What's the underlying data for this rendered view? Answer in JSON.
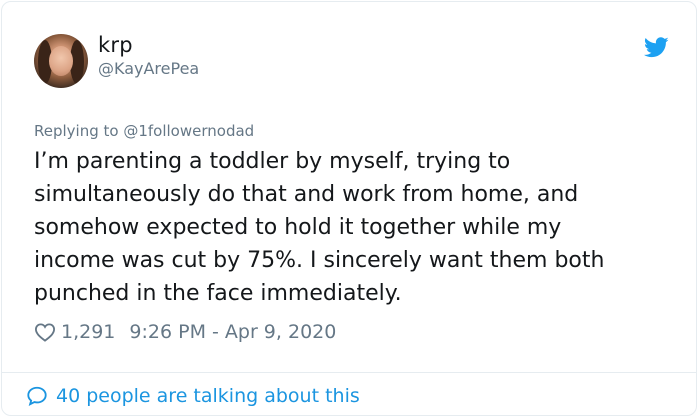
{
  "author": {
    "display_name": "krp",
    "handle": "@KayArePea"
  },
  "reply": {
    "prefix": "Replying to ",
    "mention": "@1followernodad"
  },
  "tweet": {
    "text": "I’m parenting a toddler by myself, trying to\nsimultaneously do that and work from home, and\nsomehow expected to hold it together while my\nincome was cut by 75%. I sincerely want them both\npunched in the face immediately."
  },
  "meta": {
    "likes": "1,291",
    "timestamp": "9:26 PM - Apr 9, 2020"
  },
  "footer": {
    "talking_label": "40 people are talking about this"
  },
  "icons": {
    "brand": "twitter-bird-icon",
    "like": "heart-icon",
    "conversation": "speech-bubble-icon"
  },
  "colors": {
    "brand_blue": "#1da1f2",
    "link_blue": "#1b95e0",
    "secondary_text": "#657786",
    "primary_text": "#14171a",
    "border": "#e6ecf0"
  }
}
